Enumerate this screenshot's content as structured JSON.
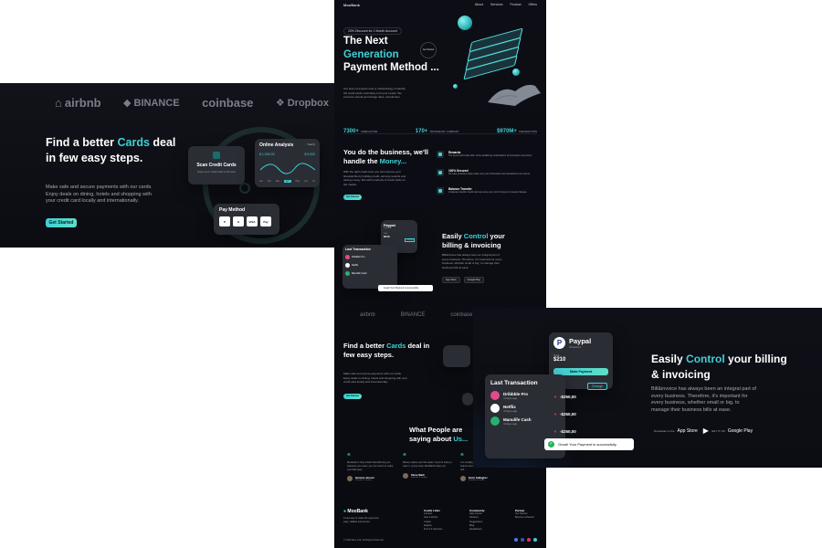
{
  "left": {
    "logos": [
      "airbnb",
      "BINANCE",
      "coinbase",
      "Dropbox"
    ],
    "headline_pre": "Find a better ",
    "headline_accent": "Cards",
    "headline_post": " deal in few easy steps.",
    "desc": "Make safe and secure payments with our cards. Enjoy deals on dining, hotels and shopping with your credit card locally and internationally.",
    "cta": "Get Started",
    "scan_card": {
      "title": "Scan Credit Cards",
      "sub": "Scan your credit card to fill auto"
    },
    "online_analysis": {
      "title": "Online Analysis",
      "period": "Yearly",
      "left_value": "$ 1,000.00",
      "right_value": "$ 5,000",
      "months": [
        "Jan",
        "Feb",
        "Mar",
        "Apr",
        "May",
        "Jun",
        "Jul"
      ],
      "active_month": "Apr"
    },
    "pay_method": {
      "title": "Pay Method",
      "options": [
        "P",
        "G",
        "VISA",
        "Pay"
      ]
    }
  },
  "center": {
    "nav": {
      "logo": "MooBank",
      "links": [
        "About",
        "Services",
        "Product",
        "Offers"
      ]
    },
    "pill": "20% Discount for 1 Month Account",
    "hero_pre": "The Next",
    "hero_accent": "Generation",
    "hero_post": "Payment Method ...",
    "hero_desc": "Our team of experts uses a methodology to identify the credit cards most likely to fit your needs. We examine annual percentage rates, annual fees.",
    "badge": "Get Started",
    "stats": [
      {
        "n": "7300+",
        "l": "USER ACTIVE"
      },
      {
        "n": "170+",
        "l": "TRUSTED BY COMPANY"
      },
      {
        "n": "$970M+",
        "l": "TRANSACTION"
      }
    ],
    "biz_pre": "You do the business, we'll handle the ",
    "biz_accent": "Money...",
    "biz_desc": "With the right credit card, you can improve your financial life by building credit, earning rewards and saving money. But with hundreds of credit cards on the market.",
    "biz_btn": "Get Started",
    "features": [
      {
        "t": "Rewards",
        "d": "The best credit cards offer some tantalizing combinations of promotions and prizes"
      },
      {
        "t": "100% Secured",
        "d": "We take proactive steps make sure your information and transactions are secure."
      },
      {
        "t": "Balance Transfer",
        "d": "A balance transfer credit card can save you a lot of money in interest charges."
      }
    ],
    "billing_pre": "Easily ",
    "billing_accent": "Control",
    "billing_post": " your billing & invoicing",
    "billing_desc": "Bill&Invoice has always been an integral part of every business. Therefore, it's important for every business, whether small or big, to manage their business bills at ease.",
    "mini_paypal": {
      "name": "Paypal",
      "sub": "Checkout",
      "total": "Total",
      "amount": "$210",
      "change": "Change",
      "make": "Make Payment"
    },
    "mini_lt": {
      "title": "Last Transaction",
      "rows": [
        "Dribbble Pro",
        "Netflix",
        "Manulife Cash"
      ]
    },
    "mini_toast": "Great! Your Payment is successfully.",
    "stores": [
      "App Store",
      "Google Play"
    ],
    "logos": [
      "airbnb",
      "BINANCE",
      "coinbase"
    ],
    "cards_pre": "Find a better ",
    "cards_accent": "Cards",
    "cards_post": " deal in few easy steps.",
    "cards_desc": "Make safe and secure payments with our cards. Enjoy deals on dining, hotels and shopping with your credit card locally and internationally.",
    "cards_btn": "Get Started",
    "people_pre": "What People are saying about ",
    "people_accent": "Us...",
    "testimonials": [
      {
        "d": "Moobank is truly a bank that will help you wherever you need, you can trust it to make your bills easy.",
        "name": "Herman Jensen",
        "role": "Founder & Leader"
      },
      {
        "d": "Money makes your life easier. If you're lucky to have it, you're lucky. MooBank helps you.",
        "name": "Steve Mark",
        "role": "Founder & Leader"
      },
      {
        "d": "It is usually people in the money business, finance and international trade that are really rich.",
        "name": "Kenn Gallagher",
        "role": "Founder & Leader"
      }
    ],
    "footer": {
      "logo": "MooBank",
      "tagline": "A new way to make the payments easy, reliable and secure.",
      "cols": [
        {
          "h": "Useful Links",
          "items": [
            "Content",
            "How it Works",
            "Create",
            "Explore",
            "Terms & Services"
          ]
        },
        {
          "h": "Community",
          "items": [
            "Help Center",
            "Partners",
            "Suggestions",
            "Blog",
            "Newsletters"
          ]
        },
        {
          "h": "Partner",
          "items": [
            "Our Partner",
            "Become a Partner"
          ]
        }
      ],
      "copy": "© 2022 Moo Link. All Rights Reserved."
    }
  },
  "right": {
    "title_pre": "Easily ",
    "title_accent": "Control",
    "title_post": " your billing & invoicing",
    "desc": "Bill&invoice has always been an integral part of every business. Therefore, it's important for every business, whether small or big, to manage their business bills at ease.",
    "stores": [
      {
        "sub": "Download on the",
        "name": "App Store"
      },
      {
        "sub": "GET IT ON",
        "name": "Google Play"
      }
    ],
    "paypal": {
      "name": "Paypal",
      "sub": "Checkout",
      "total_label": "Total",
      "amount": "$210",
      "change": "Change",
      "make": "Make Payment"
    },
    "last_transaction": {
      "title": "Last Transaction",
      "rows": [
        {
          "name": "Dribbble Pro",
          "time": "4 Days ago",
          "amount": "-$250,00",
          "color": "#e24a8d"
        },
        {
          "name": "Netflix",
          "time": "4 Days ago",
          "amount": "-$250,00",
          "color": "#ffffff"
        },
        {
          "name": "Manulife Cash",
          "time": "4 Days ago",
          "amount": "-$250,00",
          "color": "#27b074"
        }
      ]
    },
    "toast": "Great! Your Payment is successfully."
  }
}
